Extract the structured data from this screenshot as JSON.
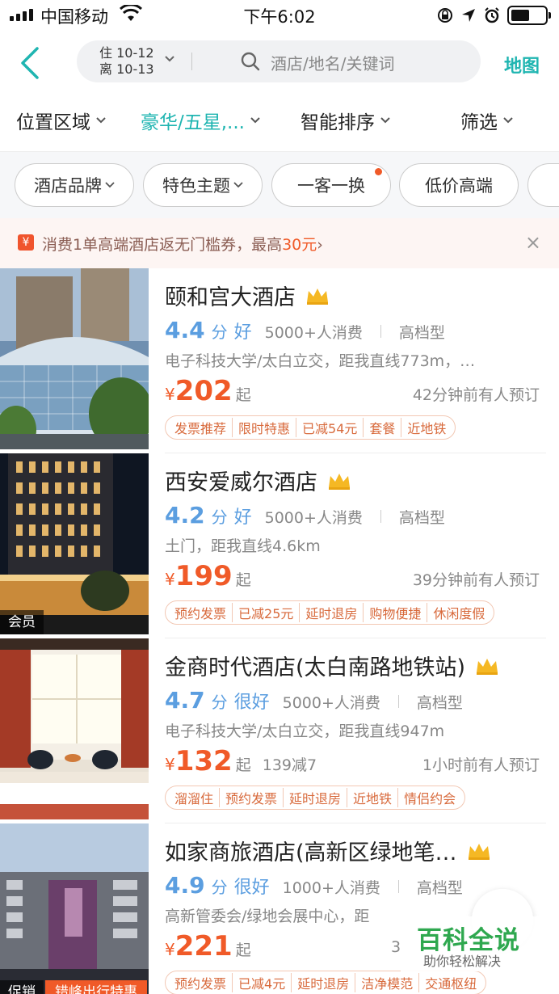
{
  "status_bar": {
    "carrier": "中国移动",
    "time": "下午6:02"
  },
  "search": {
    "checkin": "住 10-12",
    "checkout": "离 10-13",
    "placeholder": "酒店/地名/关键词",
    "map_label": "地图"
  },
  "filters": [
    {
      "label": "位置区域",
      "active": false
    },
    {
      "label": "豪华/五星,...",
      "active": true
    },
    {
      "label": "智能排序",
      "active": false
    },
    {
      "label": "筛选",
      "active": false
    }
  ],
  "quick_tags": [
    {
      "label": "酒店品牌",
      "dropdown": true
    },
    {
      "label": "特色主题",
      "dropdown": true
    },
    {
      "label": "一客一换",
      "dropdown": false,
      "dot": true
    },
    {
      "label": "低价高端",
      "dropdown": false
    }
  ],
  "promo": {
    "icon_text": "¥",
    "text_prefix": "消费1单高端酒店返无门槛券，最高",
    "highlight": "30元",
    "chevron": "›",
    "close": "×"
  },
  "hotels": [
    {
      "name": "颐和宫大酒店",
      "score": "4.4",
      "score_unit": "分",
      "score_word": "好",
      "consumers": "5000+人消费",
      "grade": "高档型",
      "location": "电子科技大学/太白立交，距我直线773m，…",
      "currency": "¥",
      "price": "202",
      "price_suffix": "起",
      "discount": "",
      "booked": "42分钟前有人预订",
      "badge": "",
      "badge2": "",
      "tags": [
        "发票推荐",
        "限时特惠",
        "已减54元",
        "套餐",
        "近地铁"
      ]
    },
    {
      "name": "西安爱威尔酒店",
      "score": "4.2",
      "score_unit": "分",
      "score_word": "好",
      "consumers": "5000+人消费",
      "grade": "高档型",
      "location": "土门，距我直线4.6km",
      "currency": "¥",
      "price": "199",
      "price_suffix": "起",
      "discount": "",
      "booked": "39分钟前有人预订",
      "badge": "会员",
      "badge2": "",
      "tags": [
        "预约发票",
        "已减25元",
        "延时退房",
        "购物便捷",
        "休闲度假"
      ]
    },
    {
      "name": "金商时代酒店(太白南路地铁站)",
      "score": "4.7",
      "score_unit": "分",
      "score_word": "很好",
      "consumers": "5000+人消费",
      "grade": "高档型",
      "location": "电子科技大学/太白立交，距我直线947m",
      "currency": "¥",
      "price": "132",
      "price_suffix": "起",
      "discount": "139减7",
      "booked": "1小时前有人预订",
      "badge": "",
      "badge2": "",
      "tags": [
        "溜溜住",
        "预约发票",
        "延时退房",
        "近地铁",
        "情侣约会"
      ]
    },
    {
      "name": "如家商旅酒店(高新区绿地笔…",
      "score": "4.9",
      "score_unit": "分",
      "score_word": "很好",
      "consumers": "1000+人消费",
      "grade": "高档型",
      "location": "高新管委会/绿地会展中心，距",
      "currency": "¥",
      "price": "221",
      "price_suffix": "起",
      "discount": "",
      "booked": "3",
      "badge": "促销",
      "badge2": "错峰出行特惠",
      "tags": [
        "预约发票",
        "已减4元",
        "延时退房",
        "洁净模范",
        "交通枢纽"
      ]
    }
  ],
  "watermark": {
    "title": "百科全说",
    "subtitle": "助你轻松解决"
  },
  "colors": {
    "accent": "#1fb5b1",
    "score": "#5b9ee0",
    "price": "#f05a28",
    "crown": "#f5b824"
  },
  "icons": [
    "signal-icon",
    "wifi-icon",
    "lock-rotation-icon",
    "location-arrow-icon",
    "alarm-icon",
    "battery-icon",
    "back-icon",
    "chevron-down-icon",
    "search-icon",
    "crown-icon",
    "close-icon"
  ]
}
